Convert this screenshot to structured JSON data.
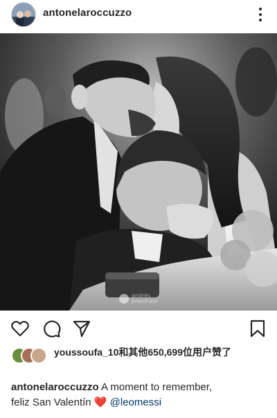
{
  "post": {
    "username": "antonelaroccuzzo",
    "watermark_line1": "andrés",
    "watermark_line2": "preumayr"
  },
  "likes": {
    "liker": "youssoufa_10",
    "rest": "和其他650,699位用户赞了"
  },
  "caption": {
    "username": "antonelaroccuzzo",
    "text_line1": "A moment to remember,",
    "text_line2": "feliz San Valentín",
    "emoji": "❤️",
    "mention": "@leomessi"
  },
  "icons": [
    "more-icon",
    "heart-icon",
    "comment-icon",
    "share-icon",
    "bookmark-icon"
  ],
  "colors": {
    "text": "#262626",
    "mention": "#00376b",
    "heart": "#ed4956"
  }
}
